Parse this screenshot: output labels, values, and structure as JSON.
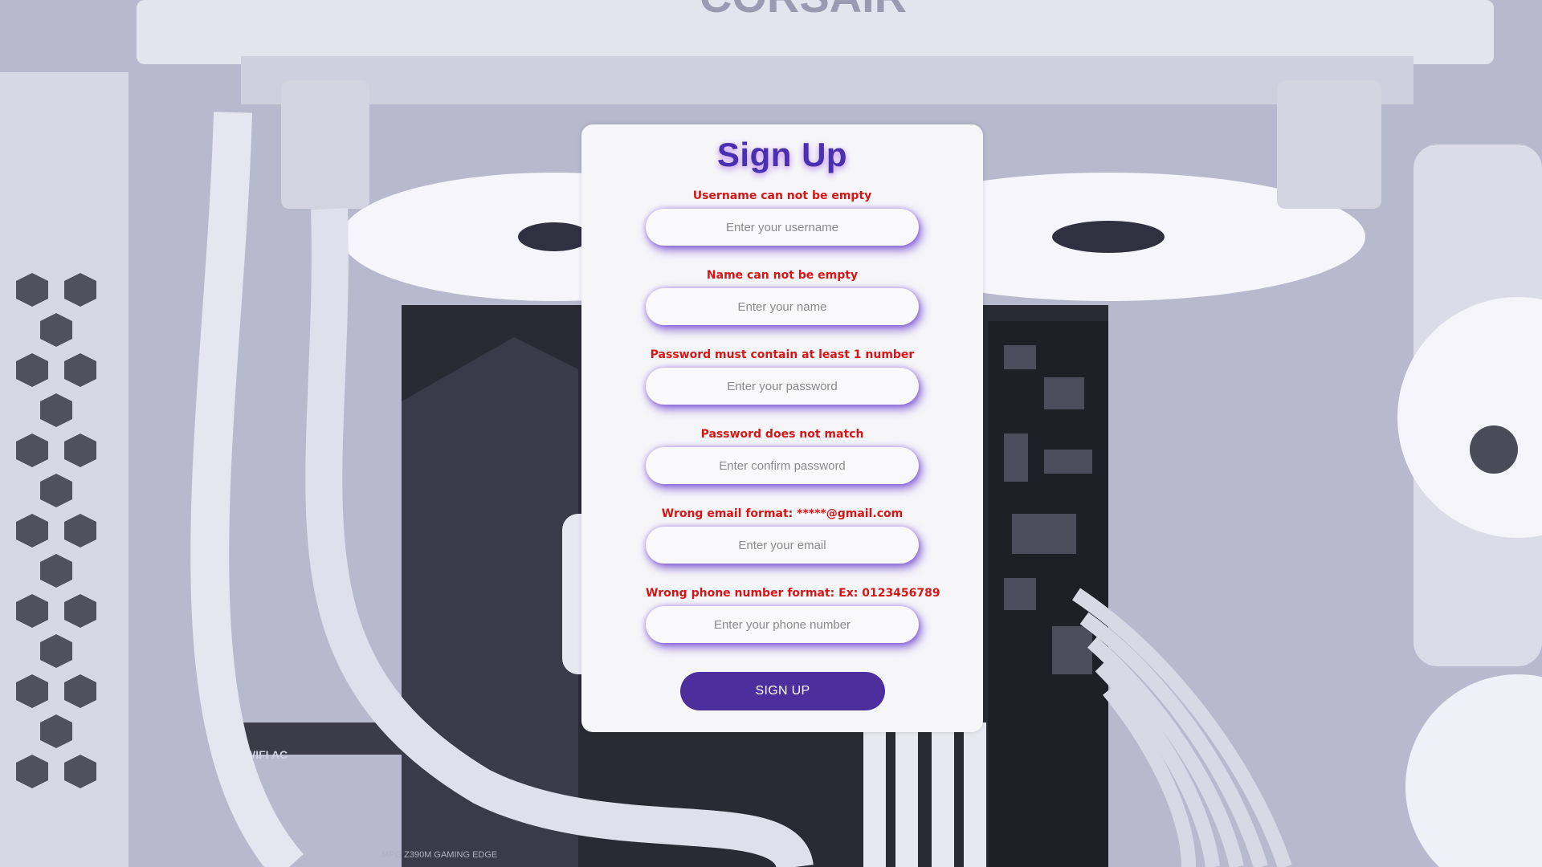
{
  "form": {
    "title": "Sign Up",
    "fields": [
      {
        "error": "Username can not be empty",
        "placeholder": "Enter your username"
      },
      {
        "error": "Name can not be empty",
        "placeholder": "Enter your name"
      },
      {
        "error": "Password must contain at least 1 number",
        "placeholder": "Enter your password"
      },
      {
        "error": "Password does not match",
        "placeholder": "Enter confirm password"
      },
      {
        "error": "Wrong email format: *****@gmail.com",
        "placeholder": "Enter your email"
      },
      {
        "error": "Wrong phone number format: Ex: 0123456789",
        "placeholder": "Enter your phone number"
      }
    ],
    "submit_label": "SIGN UP"
  },
  "colors": {
    "accent": "#4c2f9c",
    "title": "#4a2fb0",
    "error": "#d61616",
    "card": "#f6f6f8"
  },
  "background": {
    "image": "pc-case-interior",
    "brand_text": "CORSAIR",
    "label_wifi": "WIFI AC",
    "label_board": "MPG Z390M GAMING EDGE"
  }
}
